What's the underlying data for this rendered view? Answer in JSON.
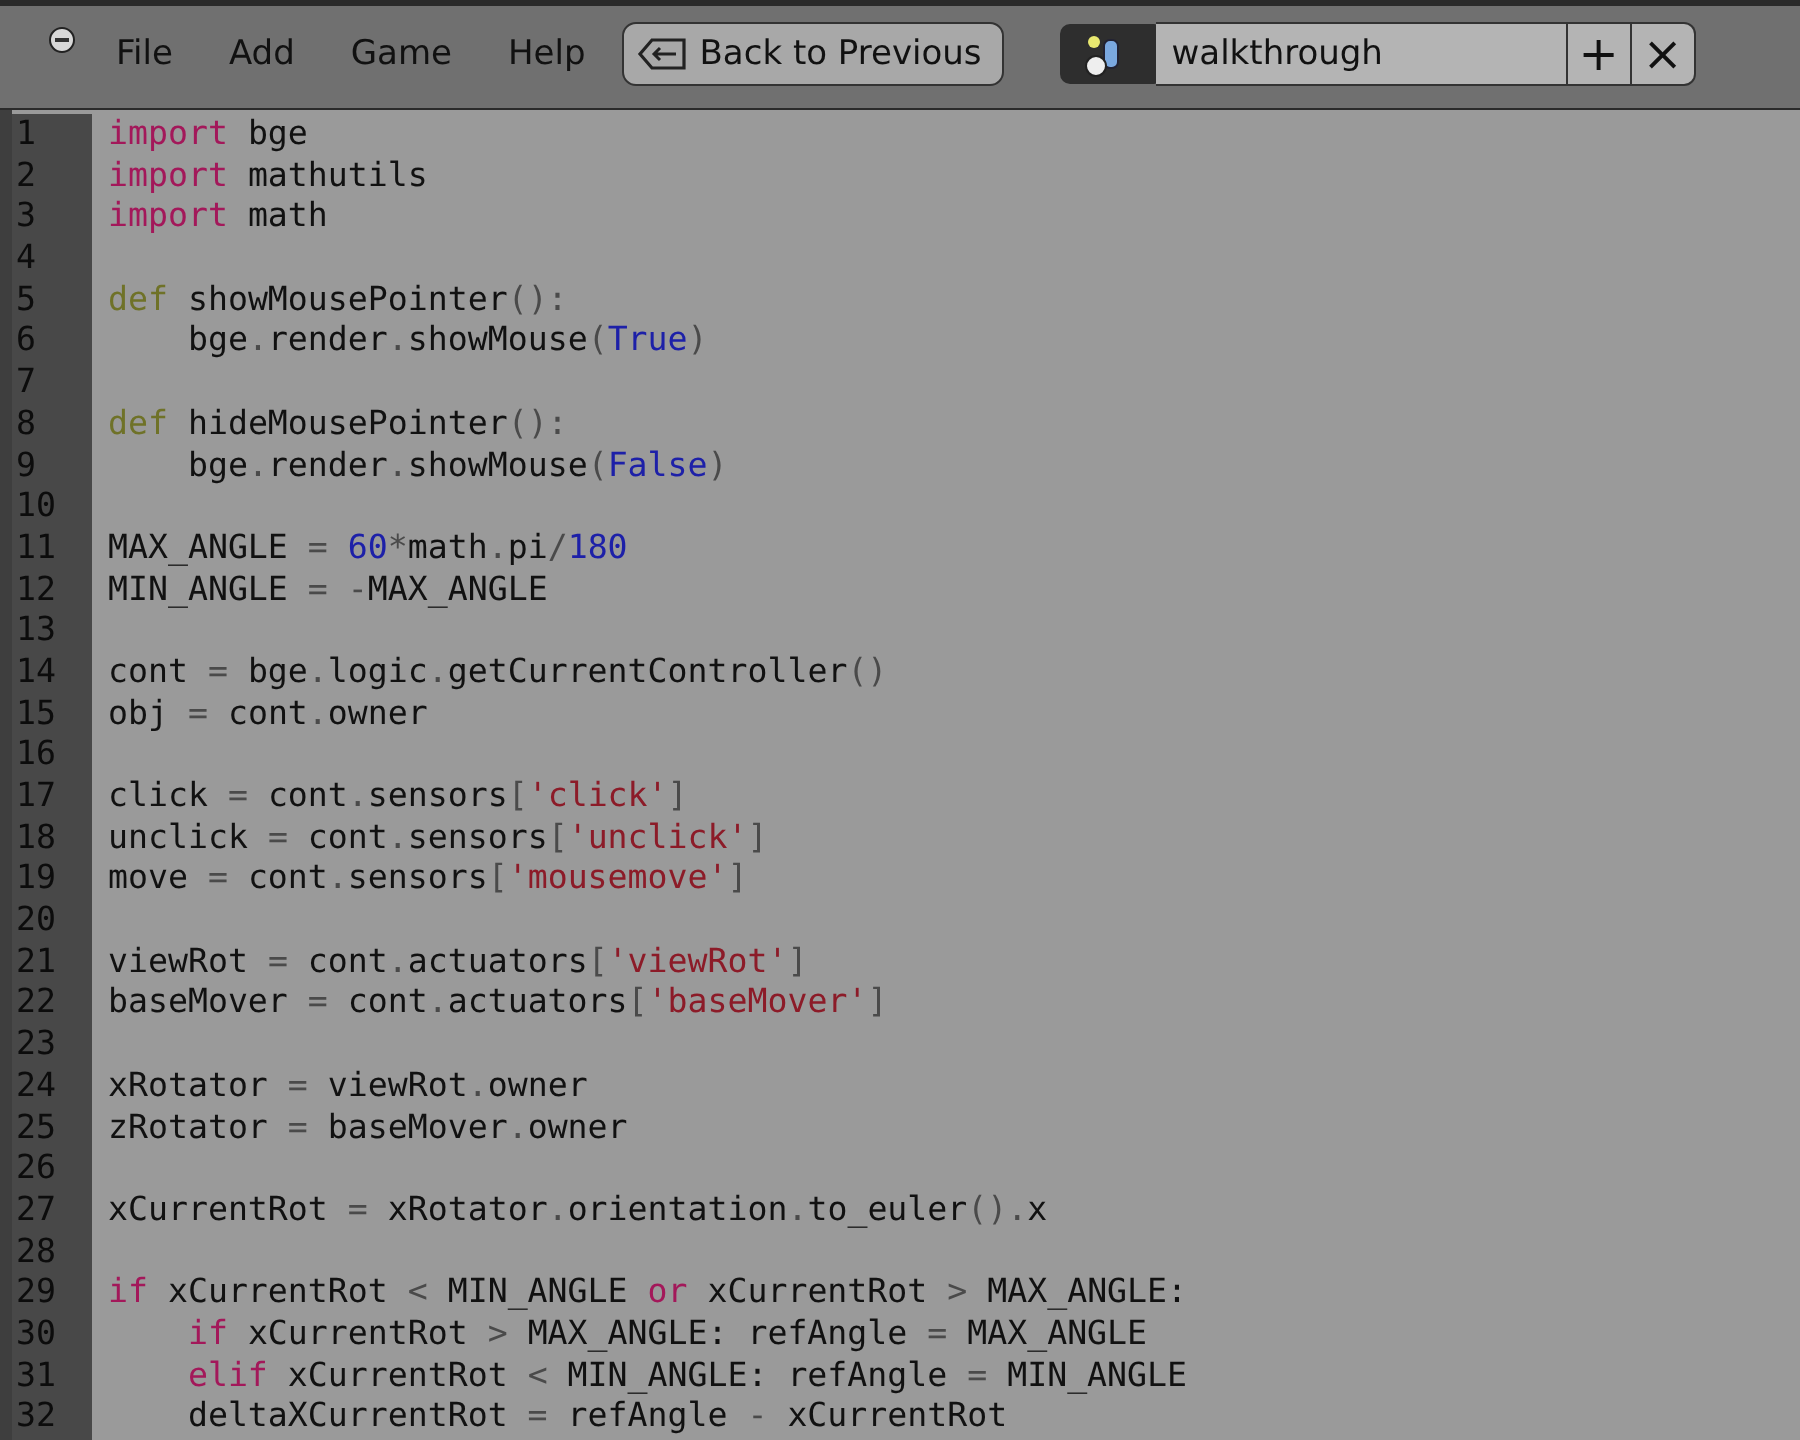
{
  "header": {
    "menus": [
      "File",
      "Add",
      "Game",
      "Help"
    ],
    "back_button": "Back to Previous",
    "datablock_name": "walkthrough",
    "add_button": "+",
    "close_button": "×"
  },
  "editor": {
    "lines": [
      {
        "number": "1",
        "tokens": [
          {
            "kind": "keyword",
            "text": "import"
          },
          {
            "kind": "plain",
            "text": " bge"
          }
        ]
      },
      {
        "number": "2",
        "tokens": [
          {
            "kind": "keyword",
            "text": "import"
          },
          {
            "kind": "plain",
            "text": " mathutils"
          }
        ]
      },
      {
        "number": "3",
        "tokens": [
          {
            "kind": "keyword",
            "text": "import"
          },
          {
            "kind": "plain",
            "text": " math"
          }
        ]
      },
      {
        "number": "4"
      },
      {
        "number": "5",
        "tokens": [
          {
            "kind": "def",
            "text": "def"
          },
          {
            "kind": "plain",
            "text": " showMousePointer"
          },
          {
            "kind": "punct",
            "text": "():"
          }
        ]
      },
      {
        "number": "6",
        "tokens": [
          {
            "kind": "plain",
            "text": "    bge"
          },
          {
            "kind": "punct",
            "text": "."
          },
          {
            "kind": "plain",
            "text": "render"
          },
          {
            "kind": "punct",
            "text": "."
          },
          {
            "kind": "plain",
            "text": "showMouse"
          },
          {
            "kind": "punct",
            "text": "("
          },
          {
            "kind": "builtin",
            "text": "True"
          },
          {
            "kind": "punct",
            "text": ")"
          }
        ]
      },
      {
        "number": "7"
      },
      {
        "number": "8",
        "tokens": [
          {
            "kind": "def",
            "text": "def"
          },
          {
            "kind": "plain",
            "text": " hideMousePointer"
          },
          {
            "kind": "punct",
            "text": "():"
          }
        ]
      },
      {
        "number": "9",
        "tokens": [
          {
            "kind": "plain",
            "text": "    bge"
          },
          {
            "kind": "punct",
            "text": "."
          },
          {
            "kind": "plain",
            "text": "render"
          },
          {
            "kind": "punct",
            "text": "."
          },
          {
            "kind": "plain",
            "text": "showMouse"
          },
          {
            "kind": "punct",
            "text": "("
          },
          {
            "kind": "builtin",
            "text": "False"
          },
          {
            "kind": "punct",
            "text": ")"
          }
        ]
      },
      {
        "number": "10"
      },
      {
        "number": "11",
        "tokens": [
          {
            "kind": "plain",
            "text": "MAX_ANGLE "
          },
          {
            "kind": "punct",
            "text": "= "
          },
          {
            "kind": "number",
            "text": "60"
          },
          {
            "kind": "punct",
            "text": "*"
          },
          {
            "kind": "plain",
            "text": "math"
          },
          {
            "kind": "punct",
            "text": "."
          },
          {
            "kind": "plain",
            "text": "pi"
          },
          {
            "kind": "punct",
            "text": "/"
          },
          {
            "kind": "number",
            "text": "180"
          }
        ]
      },
      {
        "number": "12",
        "tokens": [
          {
            "kind": "plain",
            "text": "MIN_ANGLE "
          },
          {
            "kind": "punct",
            "text": "= -"
          },
          {
            "kind": "plain",
            "text": "MAX_ANGLE"
          }
        ]
      },
      {
        "number": "13"
      },
      {
        "number": "14",
        "tokens": [
          {
            "kind": "plain",
            "text": "cont "
          },
          {
            "kind": "punct",
            "text": "="
          },
          {
            "kind": "plain",
            "text": " bge"
          },
          {
            "kind": "punct",
            "text": "."
          },
          {
            "kind": "plain",
            "text": "logic"
          },
          {
            "kind": "punct",
            "text": "."
          },
          {
            "kind": "plain",
            "text": "getCurrentController"
          },
          {
            "kind": "punct",
            "text": "()"
          }
        ]
      },
      {
        "number": "15",
        "tokens": [
          {
            "kind": "plain",
            "text": "obj "
          },
          {
            "kind": "punct",
            "text": "="
          },
          {
            "kind": "plain",
            "text": " cont"
          },
          {
            "kind": "punct",
            "text": "."
          },
          {
            "kind": "plain",
            "text": "owner"
          }
        ]
      },
      {
        "number": "16"
      },
      {
        "number": "17",
        "tokens": [
          {
            "kind": "plain",
            "text": "click "
          },
          {
            "kind": "punct",
            "text": "="
          },
          {
            "kind": "plain",
            "text": " cont"
          },
          {
            "kind": "punct",
            "text": "."
          },
          {
            "kind": "plain",
            "text": "sensors"
          },
          {
            "kind": "punct",
            "text": "["
          },
          {
            "kind": "string",
            "text": "'click'"
          },
          {
            "kind": "punct",
            "text": "]"
          }
        ]
      },
      {
        "number": "18",
        "tokens": [
          {
            "kind": "plain",
            "text": "unclick "
          },
          {
            "kind": "punct",
            "text": "="
          },
          {
            "kind": "plain",
            "text": " cont"
          },
          {
            "kind": "punct",
            "text": "."
          },
          {
            "kind": "plain",
            "text": "sensors"
          },
          {
            "kind": "punct",
            "text": "["
          },
          {
            "kind": "string",
            "text": "'unclick'"
          },
          {
            "kind": "punct",
            "text": "]"
          }
        ]
      },
      {
        "number": "19",
        "tokens": [
          {
            "kind": "plain",
            "text": "move "
          },
          {
            "kind": "punct",
            "text": "="
          },
          {
            "kind": "plain",
            "text": " cont"
          },
          {
            "kind": "punct",
            "text": "."
          },
          {
            "kind": "plain",
            "text": "sensors"
          },
          {
            "kind": "punct",
            "text": "["
          },
          {
            "kind": "string",
            "text": "'mousemove'"
          },
          {
            "kind": "punct",
            "text": "]"
          }
        ]
      },
      {
        "number": "20"
      },
      {
        "number": "21",
        "tokens": [
          {
            "kind": "plain",
            "text": "viewRot "
          },
          {
            "kind": "punct",
            "text": "="
          },
          {
            "kind": "plain",
            "text": " cont"
          },
          {
            "kind": "punct",
            "text": "."
          },
          {
            "kind": "plain",
            "text": "actuators"
          },
          {
            "kind": "punct",
            "text": "["
          },
          {
            "kind": "string",
            "text": "'viewRot'"
          },
          {
            "kind": "punct",
            "text": "]"
          }
        ]
      },
      {
        "number": "22",
        "tokens": [
          {
            "kind": "plain",
            "text": "baseMover "
          },
          {
            "kind": "punct",
            "text": "="
          },
          {
            "kind": "plain",
            "text": " cont"
          },
          {
            "kind": "punct",
            "text": "."
          },
          {
            "kind": "plain",
            "text": "actuators"
          },
          {
            "kind": "punct",
            "text": "["
          },
          {
            "kind": "string",
            "text": "'baseMover'"
          },
          {
            "kind": "punct",
            "text": "]"
          }
        ]
      },
      {
        "number": "23"
      },
      {
        "number": "24",
        "tokens": [
          {
            "kind": "plain",
            "text": "xRotator "
          },
          {
            "kind": "punct",
            "text": "="
          },
          {
            "kind": "plain",
            "text": " viewRot"
          },
          {
            "kind": "punct",
            "text": "."
          },
          {
            "kind": "plain",
            "text": "owner"
          }
        ]
      },
      {
        "number": "25",
        "tokens": [
          {
            "kind": "plain",
            "text": "zRotator "
          },
          {
            "kind": "punct",
            "text": "="
          },
          {
            "kind": "plain",
            "text": " baseMover"
          },
          {
            "kind": "punct",
            "text": "."
          },
          {
            "kind": "plain",
            "text": "owner"
          }
        ]
      },
      {
        "number": "26"
      },
      {
        "number": "27",
        "tokens": [
          {
            "kind": "plain",
            "text": "xCurrentRot "
          },
          {
            "kind": "punct",
            "text": "="
          },
          {
            "kind": "plain",
            "text": " xRotator"
          },
          {
            "kind": "punct",
            "text": "."
          },
          {
            "kind": "plain",
            "text": "orientation"
          },
          {
            "kind": "punct",
            "text": "."
          },
          {
            "kind": "plain",
            "text": "to_euler"
          },
          {
            "kind": "punct",
            "text": "()."
          },
          {
            "kind": "plain",
            "text": "x"
          }
        ]
      },
      {
        "number": "28"
      },
      {
        "number": "29",
        "tokens": [
          {
            "kind": "keyword",
            "text": "if"
          },
          {
            "kind": "plain",
            "text": " xCurrentRot "
          },
          {
            "kind": "punct",
            "text": "<"
          },
          {
            "kind": "plain",
            "text": " MIN_ANGLE "
          },
          {
            "kind": "keyword",
            "text": "or"
          },
          {
            "kind": "plain",
            "text": " xCurrentRot "
          },
          {
            "kind": "punct",
            "text": ">"
          },
          {
            "kind": "plain",
            "text": " MAX_ANGLE:"
          }
        ]
      },
      {
        "number": "30",
        "tokens": [
          {
            "kind": "keyword",
            "text": "    if"
          },
          {
            "kind": "plain",
            "text": " xCurrentRot "
          },
          {
            "kind": "punct",
            "text": ">"
          },
          {
            "kind": "plain",
            "text": " MAX_ANGLE: refAngle "
          },
          {
            "kind": "punct",
            "text": "="
          },
          {
            "kind": "plain",
            "text": " MAX_ANGLE"
          }
        ]
      },
      {
        "number": "31",
        "tokens": [
          {
            "kind": "keyword",
            "text": "    elif"
          },
          {
            "kind": "plain",
            "text": " xCurrentRot "
          },
          {
            "kind": "punct",
            "text": "<"
          },
          {
            "kind": "plain",
            "text": " MIN_ANGLE: refAngle "
          },
          {
            "kind": "punct",
            "text": "="
          },
          {
            "kind": "plain",
            "text": " MIN_ANGLE"
          }
        ]
      },
      {
        "number": "32",
        "tokens": [
          {
            "kind": "plain",
            "text": "    deltaXCurrentRot "
          },
          {
            "kind": "punct",
            "text": "="
          },
          {
            "kind": "plain",
            "text": " refAngle "
          },
          {
            "kind": "punct",
            "text": "-"
          },
          {
            "kind": "plain",
            "text": " xCurrentRot"
          }
        ]
      }
    ]
  }
}
